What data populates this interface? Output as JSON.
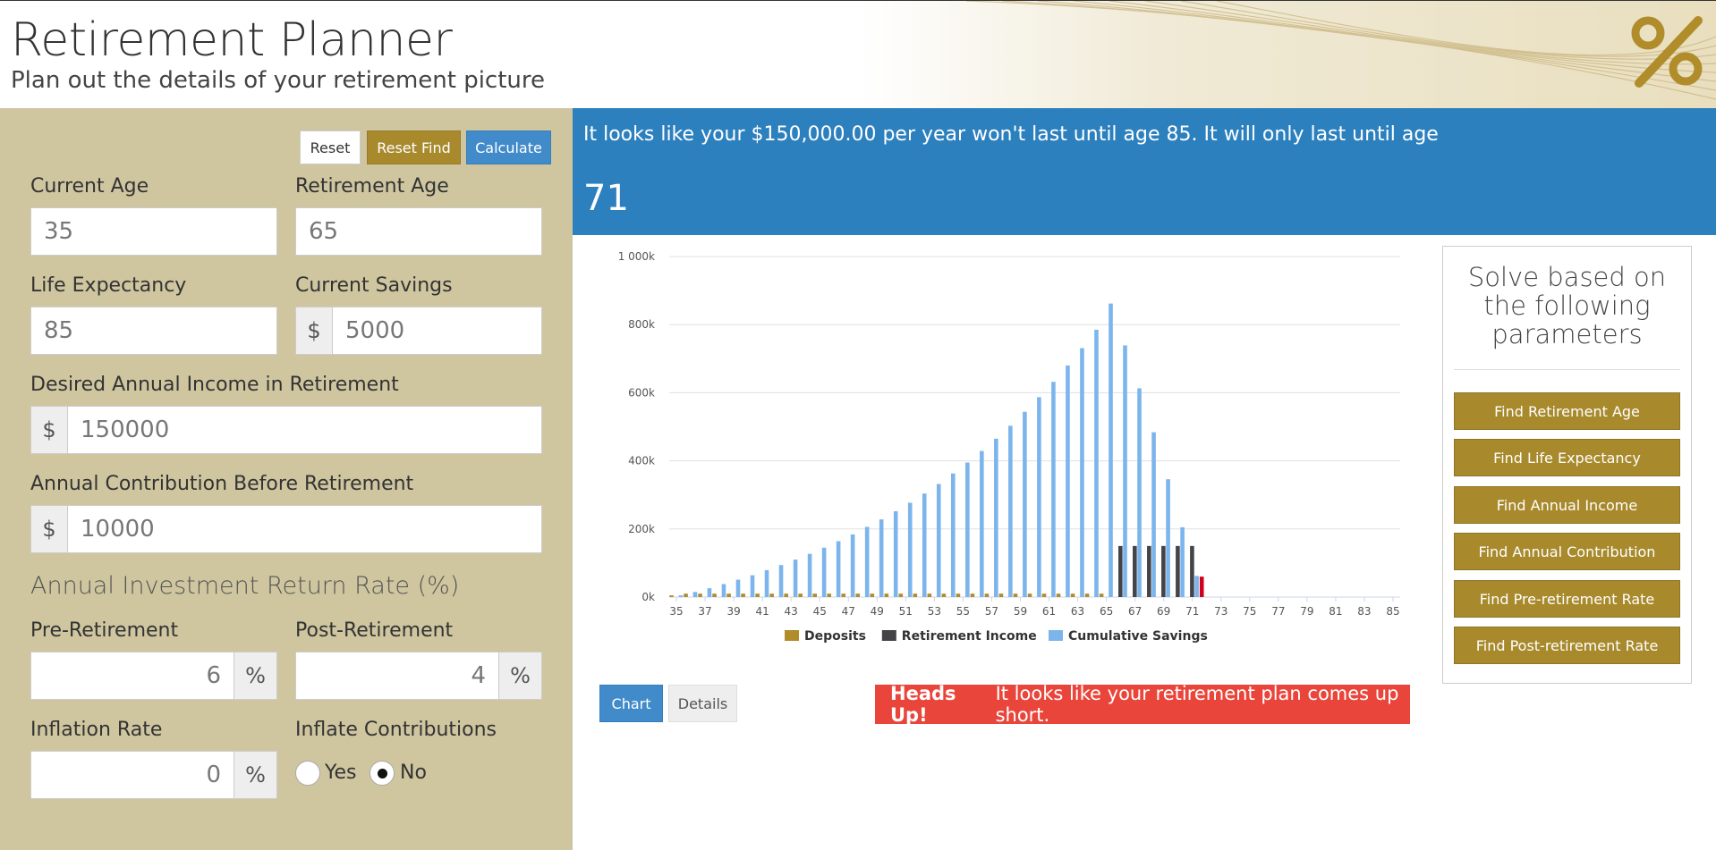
{
  "header": {
    "title": "Retirement Planner",
    "subtitle": "Plan out the details of your retirement picture",
    "icon": "percent-icon",
    "accent": "#b08d2a"
  },
  "toolbar": {
    "reset_label": "Reset",
    "reset_find_label": "Reset Find",
    "calculate_label": "Calculate"
  },
  "form": {
    "current_age": {
      "label": "Current Age",
      "value": "35"
    },
    "retirement_age": {
      "label": "Retirement Age",
      "value": "65"
    },
    "life_expectancy": {
      "label": "Life Expectancy",
      "value": "85"
    },
    "current_savings": {
      "label": "Current Savings",
      "prefix": "$",
      "value": "5000"
    },
    "desired_income": {
      "label": "Desired Annual Income in Retirement",
      "prefix": "$",
      "value": "150000"
    },
    "annual_contribution": {
      "label": "Annual Contribution Before Retirement",
      "prefix": "$",
      "value": "10000"
    },
    "return_heading": "Annual Investment Return Rate (%)",
    "pre_retirement": {
      "label": "Pre-Retirement",
      "value": "6",
      "suffix": "%"
    },
    "post_retirement": {
      "label": "Post-Retirement",
      "value": "4",
      "suffix": "%"
    },
    "inflation_rate": {
      "label": "Inflation Rate",
      "value": "0",
      "suffix": "%"
    },
    "inflate_contributions": {
      "label": "Inflate Contributions",
      "yes": "Yes",
      "no": "No",
      "selected": "No"
    }
  },
  "banner": {
    "message": "It looks like your $150,000.00 per year won't last until age 85. It will only last until age",
    "age": "71",
    "color": "#2c80be"
  },
  "solve": {
    "title": "Solve based on the following parameters",
    "buttons": [
      "Find Retirement Age",
      "Find Life Expectancy",
      "Find Annual Income",
      "Find Annual Contribution",
      "Find Pre-retirement Rate",
      "Find Post-retirement Rate"
    ]
  },
  "tabs": {
    "chart": "Chart",
    "details": "Details"
  },
  "alert": {
    "strong": "Heads Up!",
    "text": "It looks like your retirement plan comes up short.",
    "color": "#e9453b"
  },
  "chart_data": {
    "type": "bar",
    "x": [
      35,
      36,
      37,
      38,
      39,
      40,
      41,
      42,
      43,
      44,
      45,
      46,
      47,
      48,
      49,
      50,
      51,
      52,
      53,
      54,
      55,
      56,
      57,
      58,
      59,
      60,
      61,
      62,
      63,
      64,
      65,
      66,
      67,
      68,
      69,
      70,
      71,
      72,
      73,
      74,
      75,
      76,
      77,
      78,
      79,
      80,
      81,
      82,
      83,
      84,
      85
    ],
    "x_tick_labels": [
      "35",
      "37",
      "39",
      "41",
      "43",
      "45",
      "47",
      "49",
      "51",
      "53",
      "55",
      "57",
      "59",
      "61",
      "63",
      "65",
      "67",
      "69",
      "71",
      "73",
      "75",
      "77",
      "79",
      "81",
      "83",
      "85"
    ],
    "y_tick_labels": [
      "0k",
      "200k",
      "400k",
      "600k",
      "800k",
      "1 000k"
    ],
    "ylim": [
      0,
      1000000
    ],
    "series": [
      {
        "name": "Deposits",
        "color": "#b08d2a",
        "values": [
          5000,
          10000,
          10000,
          10000,
          10000,
          10000,
          10000,
          10000,
          10000,
          10000,
          10000,
          10000,
          10000,
          10000,
          10000,
          10000,
          10000,
          10000,
          10000,
          10000,
          10000,
          10000,
          10000,
          10000,
          10000,
          10000,
          10000,
          10000,
          10000,
          10000,
          10000,
          0,
          0,
          0,
          0,
          0,
          0,
          0,
          0,
          0,
          0,
          0,
          0,
          0,
          0,
          0,
          0,
          0,
          0,
          0,
          0
        ]
      },
      {
        "name": "Retirement Income",
        "color": "#434348",
        "values": [
          0,
          0,
          0,
          0,
          0,
          0,
          0,
          0,
          0,
          0,
          0,
          0,
          0,
          0,
          0,
          0,
          0,
          0,
          0,
          0,
          0,
          0,
          0,
          0,
          0,
          0,
          0,
          0,
          0,
          0,
          0,
          150000,
          150000,
          150000,
          150000,
          150000,
          150000,
          0,
          0,
          0,
          0,
          0,
          0,
          0,
          0,
          0,
          0,
          0,
          0,
          0,
          0
        ]
      },
      {
        "name": "Cumulative Savings",
        "color": "#7cb5ec",
        "values": [
          5000,
          15000,
          26000,
          38000,
          51000,
          64000,
          79000,
          94000,
          110000,
          127000,
          145000,
          164000,
          184000,
          206000,
          228000,
          252000,
          277000,
          304000,
          332000,
          363000,
          395000,
          429000,
          465000,
          503000,
          544000,
          587000,
          632000,
          680000,
          731000,
          785000,
          862000,
          739000,
          613000,
          484000,
          346000,
          205000,
          62000,
          0,
          0,
          0,
          0,
          0,
          0,
          0,
          0,
          0,
          0,
          0,
          0,
          0,
          0
        ]
      }
    ],
    "shortfall_marker": {
      "x": 71,
      "value": 62000,
      "color": "#d0021b"
    },
    "legend": "bottom-center",
    "grid": true
  }
}
